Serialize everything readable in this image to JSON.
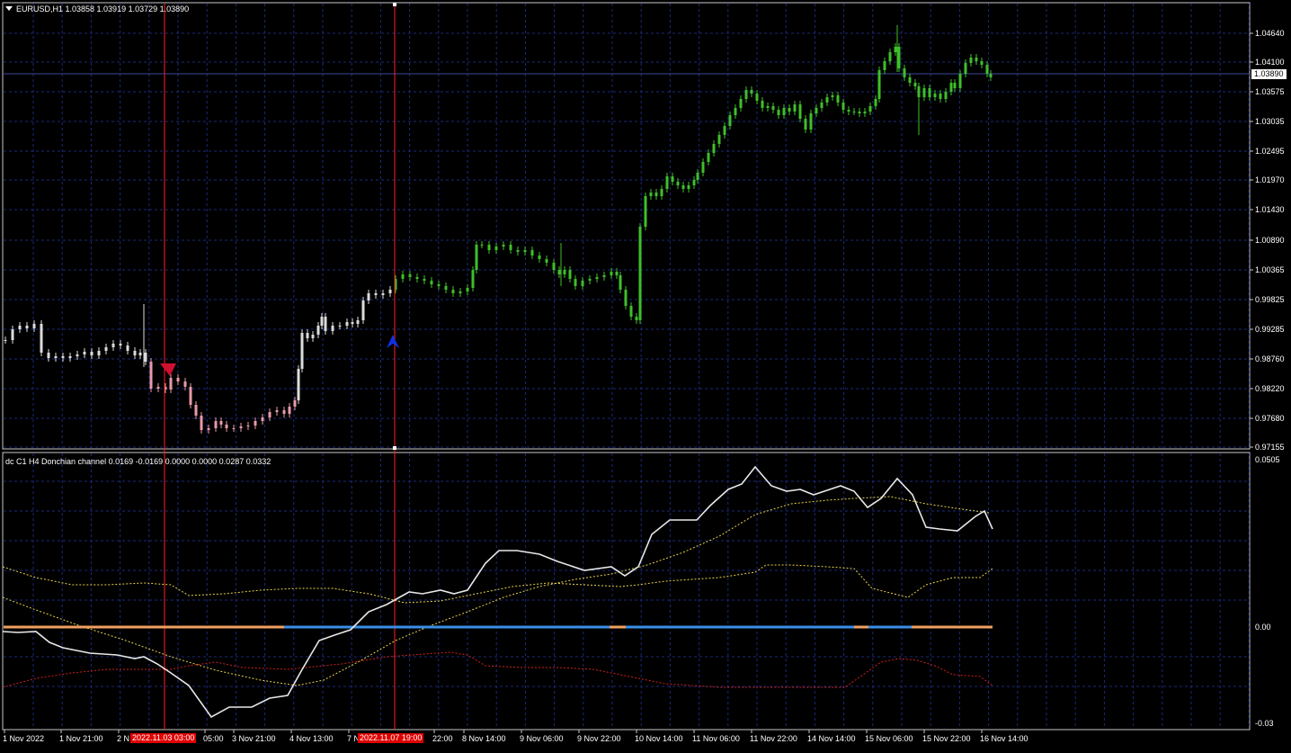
{
  "main": {
    "header": "EURUSD,H1  1.03858 1.03919 1.03729 1.03890",
    "price_levels": [
      "1.04640",
      "1.04100",
      "1.03575",
      "1.03035",
      "1.02495",
      "1.01970",
      "1.01430",
      "1.00890",
      "1.00365",
      "0.99825",
      "0.99285",
      "0.98760",
      "0.98220",
      "0.97680",
      "0.97155"
    ],
    "current_price": "1.03890"
  },
  "indicator": {
    "header": "dc C1 H4 Donchian channel 0.0169 -0.0169 0.0000 0.0000 0.0287 0.0332",
    "levels": [
      "0.0505",
      "0.00",
      "-0.03"
    ]
  },
  "time_axis": [
    "1 Nov 2022",
    "1 Nov 21:00",
    "2 N",
    "05:00",
    "3 Nov 21:00",
    "4 Nov 13:00",
    "7 N",
    "22:00",
    "8 Nov 14:00",
    "9 Nov 06:00",
    "9 Nov 22:00",
    "10 Nov 14:00",
    "11 Nov 06:00",
    "11 Nov 22:00",
    "14 Nov 14:00",
    "15 Nov 06:00",
    "15 Nov 22:00",
    "16 Nov 14:00"
  ],
  "vlines": [
    {
      "label": "2022.11.03 03:00"
    },
    {
      "label": "2022.11.07 19:00"
    }
  ],
  "colors": {
    "bull": "#3fbf2a",
    "bear_pink": "#e89aa8",
    "neutral": "#dcdcdc",
    "grid": "#1a2a7a",
    "vline": "#ff2020",
    "zero_blue": "#3a8ee6",
    "zero_orange": "#f0a060",
    "channel_yellow": "#e8d24a",
    "channel_red": "#d02020",
    "oscillator": "#e8e8e8",
    "arrow_sell": "#d01030",
    "arrow_buy": "#1030e0"
  }
}
